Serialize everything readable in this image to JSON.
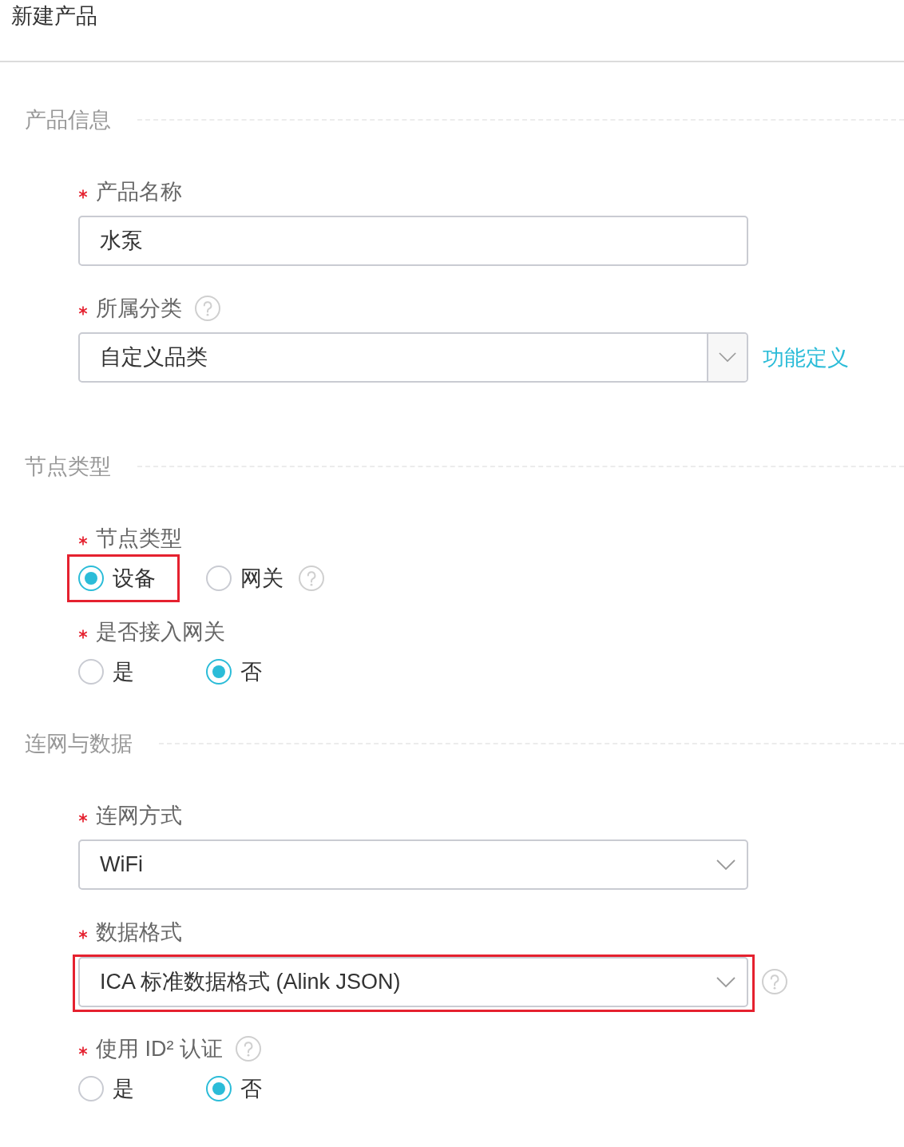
{
  "page_title": "新建产品",
  "sections": [
    {
      "title": "产品信息",
      "fields": [
        {
          "kind": "text",
          "label": "产品名称",
          "required": true,
          "help": false,
          "help_beside": false,
          "highlighted": false,
          "value": "水泵"
        },
        {
          "kind": "combo",
          "label": "所属分类",
          "required": true,
          "help": true,
          "help_beside": false,
          "highlighted": false,
          "value": "自定义品类",
          "link": "功能定义"
        }
      ]
    },
    {
      "title": "节点类型",
      "fields": [
        {
          "kind": "radio",
          "label": "节点类型",
          "required": true,
          "help": false,
          "help_beside": false,
          "highlighted": false,
          "options": [
            {
              "label": "设备",
              "selected": true,
              "highlighted": true,
              "help": false
            },
            {
              "label": "网关",
              "selected": false,
              "highlighted": false,
              "help": true
            }
          ]
        },
        {
          "kind": "radio",
          "label": "是否接入网关",
          "required": true,
          "help": false,
          "help_beside": false,
          "highlighted": false,
          "options": [
            {
              "label": "是",
              "selected": false,
              "highlighted": false,
              "help": false
            },
            {
              "label": "否",
              "selected": true,
              "highlighted": false,
              "help": false
            }
          ]
        }
      ]
    },
    {
      "title": "连网与数据",
      "fields": [
        {
          "kind": "select",
          "label": "连网方式",
          "required": true,
          "help": false,
          "help_beside": false,
          "highlighted": false,
          "value": "WiFi"
        },
        {
          "kind": "select",
          "label": "数据格式",
          "required": true,
          "help": false,
          "help_beside": true,
          "highlighted": true,
          "value": "ICA 标准数据格式 (Alink JSON)"
        },
        {
          "kind": "radio",
          "label": "使用 ID² 认证",
          "required": true,
          "help": true,
          "help_beside": false,
          "highlighted": false,
          "options": [
            {
              "label": "是",
              "selected": false,
              "highlighted": false,
              "help": false
            },
            {
              "label": "否",
              "selected": true,
              "highlighted": false,
              "help": false
            }
          ]
        }
      ]
    }
  ]
}
